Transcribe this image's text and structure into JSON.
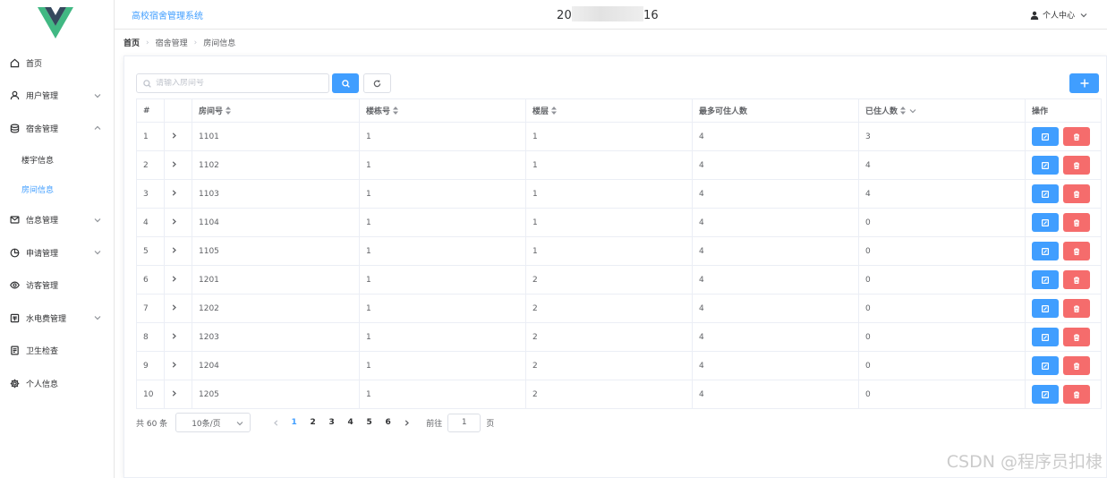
{
  "app": {
    "title": "高校宿舍管理系统",
    "datetime_prefix": "20",
    "datetime_suffix": "16",
    "user_center": "个人中心"
  },
  "sidebar": {
    "items": [
      {
        "label": "首页",
        "icon": "home-icon"
      },
      {
        "label": "用户管理",
        "icon": "user-icon",
        "has_children": true,
        "expanded": false
      },
      {
        "label": "宿舍管理",
        "icon": "database-icon",
        "has_children": true,
        "expanded": true,
        "children": [
          {
            "label": "楼宇信息"
          },
          {
            "label": "房间信息",
            "active": true
          }
        ]
      },
      {
        "label": "信息管理",
        "icon": "message-icon",
        "has_children": true,
        "expanded": false
      },
      {
        "label": "申请管理",
        "icon": "pie-chart-icon",
        "has_children": true,
        "expanded": false
      },
      {
        "label": "访客管理",
        "icon": "eye-icon"
      },
      {
        "label": "水电费管理",
        "icon": "receipt-icon",
        "has_children": true,
        "expanded": false
      },
      {
        "label": "卫生检查",
        "icon": "document-icon"
      },
      {
        "label": "个人信息",
        "icon": "gear-icon"
      }
    ]
  },
  "breadcrumb": [
    "首页",
    "宿舍管理",
    "房间信息"
  ],
  "toolbar": {
    "search_placeholder": "请输入房间号"
  },
  "table": {
    "columns": [
      "#",
      "",
      "房间号",
      "楼栋号",
      "楼层",
      "最多可住人数",
      "已住人数",
      "操作"
    ],
    "rows": [
      {
        "idx": "1",
        "room": "1101",
        "building": "1",
        "floor": "1",
        "max": "4",
        "current": "3"
      },
      {
        "idx": "2",
        "room": "1102",
        "building": "1",
        "floor": "1",
        "max": "4",
        "current": "4"
      },
      {
        "idx": "3",
        "room": "1103",
        "building": "1",
        "floor": "1",
        "max": "4",
        "current": "4"
      },
      {
        "idx": "4",
        "room": "1104",
        "building": "1",
        "floor": "1",
        "max": "4",
        "current": "0"
      },
      {
        "idx": "5",
        "room": "1105",
        "building": "1",
        "floor": "1",
        "max": "4",
        "current": "0"
      },
      {
        "idx": "6",
        "room": "1201",
        "building": "1",
        "floor": "2",
        "max": "4",
        "current": "0"
      },
      {
        "idx": "7",
        "room": "1202",
        "building": "1",
        "floor": "2",
        "max": "4",
        "current": "0"
      },
      {
        "idx": "8",
        "room": "1203",
        "building": "1",
        "floor": "2",
        "max": "4",
        "current": "0"
      },
      {
        "idx": "9",
        "room": "1204",
        "building": "1",
        "floor": "2",
        "max": "4",
        "current": "0"
      },
      {
        "idx": "10",
        "room": "1205",
        "building": "1",
        "floor": "2",
        "max": "4",
        "current": "0"
      }
    ]
  },
  "pagination": {
    "total": "共 60 条",
    "page_size": "10条/页",
    "pages": [
      "1",
      "2",
      "3",
      "4",
      "5",
      "6"
    ],
    "current_page": "1",
    "goto_label": "前往",
    "goto_value": "1",
    "page_unit": "页"
  },
  "watermark": "CSDN @程序员扣棣",
  "colors": {
    "primary": "#409eff",
    "danger": "#f56c6c",
    "logo_dark": "#35495e",
    "logo_light": "#41b883"
  }
}
